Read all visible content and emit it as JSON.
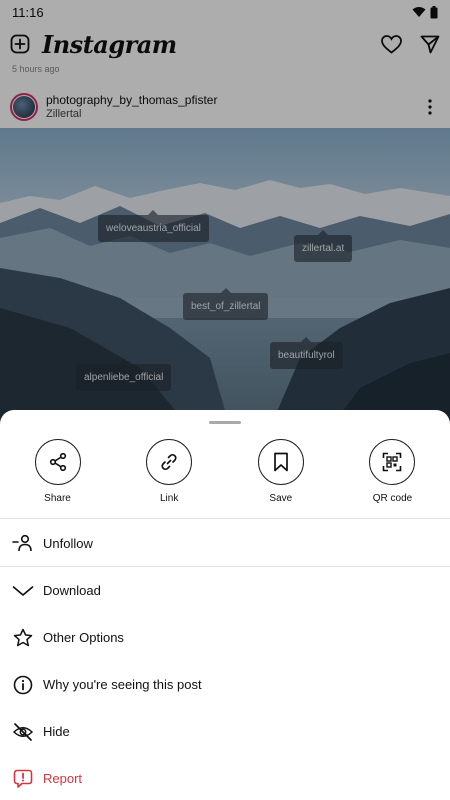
{
  "status_bar": {
    "time": "11:16"
  },
  "header": {
    "logo": "Instagram"
  },
  "feed": {
    "previous_post_time": "5 hours ago"
  },
  "post": {
    "username": "photography_by_thomas_pfister",
    "location": "Zillertal",
    "tags": [
      "weloveaustria_official",
      "zillertal.at",
      "best_of_zillertal",
      "beautifultyrol",
      "alpenliebe_official"
    ]
  },
  "sheet": {
    "actions": [
      {
        "label": "Share",
        "icon": "share-icon"
      },
      {
        "label": "Link",
        "icon": "link-icon"
      },
      {
        "label": "Save",
        "icon": "bookmark-icon"
      },
      {
        "label": "QR code",
        "icon": "qr-code-icon"
      }
    ],
    "menu": [
      {
        "label": "Unfollow",
        "icon": "unfollow-icon"
      },
      {
        "label": "Download",
        "icon": "download-icon"
      },
      {
        "label": "Other Options",
        "icon": "star-icon"
      },
      {
        "label": "Why you're seeing this post",
        "icon": "info-icon"
      },
      {
        "label": "Hide",
        "icon": "eye-off-icon"
      },
      {
        "label": "Report",
        "icon": "report-icon"
      }
    ]
  },
  "colors": {
    "danger": "#d6343f",
    "story_ring": "#d8306a"
  }
}
